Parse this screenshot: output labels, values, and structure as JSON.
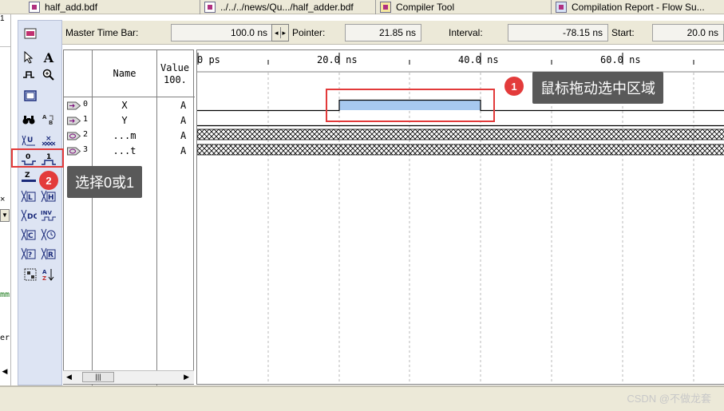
{
  "tabs": [
    {
      "label": "half_add.bdf",
      "icon": "bdf-file-icon"
    },
    {
      "label": "../../../news/Qu.../half_adder.bdf",
      "icon": "bdf-file-icon"
    },
    {
      "label": "Compiler Tool",
      "icon": "compiler-tool-icon"
    },
    {
      "label": "Compilation Report - Flow Su...",
      "icon": "compilation-report-icon"
    }
  ],
  "left_strip": {
    "items": [
      "1",
      "×",
      "mm",
      "er"
    ]
  },
  "timebar": {
    "master_label": "Master Time Bar:",
    "master_value": "100.0 ns",
    "pointer_label": "Pointer:",
    "pointer_value": "21.85 ns",
    "interval_label": "Interval:",
    "interval_value": "-78.15 ns",
    "start_label": "Start:",
    "start_value": "20.0 ns"
  },
  "signal_panel": {
    "name_header": "Name",
    "value_header_line1": "Value",
    "value_header_line2": "100.",
    "signals": [
      {
        "index": "0",
        "name": "X",
        "value": "A",
        "kind": "input"
      },
      {
        "index": "1",
        "name": "Y",
        "value": "A",
        "kind": "input"
      },
      {
        "index": "2",
        "name": "...m",
        "value": "A",
        "kind": "output"
      },
      {
        "index": "3",
        "name": "...t",
        "value": "A",
        "kind": "output"
      }
    ],
    "scroll_grip": "|||"
  },
  "wave_panel": {
    "ticks": [
      "0 ps",
      "20.0 ns",
      "40.0 ns",
      "60.0 ns"
    ]
  },
  "annotations": [
    {
      "number": "1",
      "text": "鼠标拖动选中区域"
    },
    {
      "number": "2",
      "text": "选择0或1"
    }
  ],
  "toolbar": {
    "force_low_label": "0",
    "force_high_label": "1",
    "high_z_label": "Z",
    "inv_label": "INV"
  },
  "watermark": "CSDN @不做龙套",
  "colors": {
    "selection_fill": "#a7c8ef",
    "annotation_red": "#e23a3a",
    "callout_bg": "#595959",
    "toolbar_bg": "#dde4f3"
  }
}
